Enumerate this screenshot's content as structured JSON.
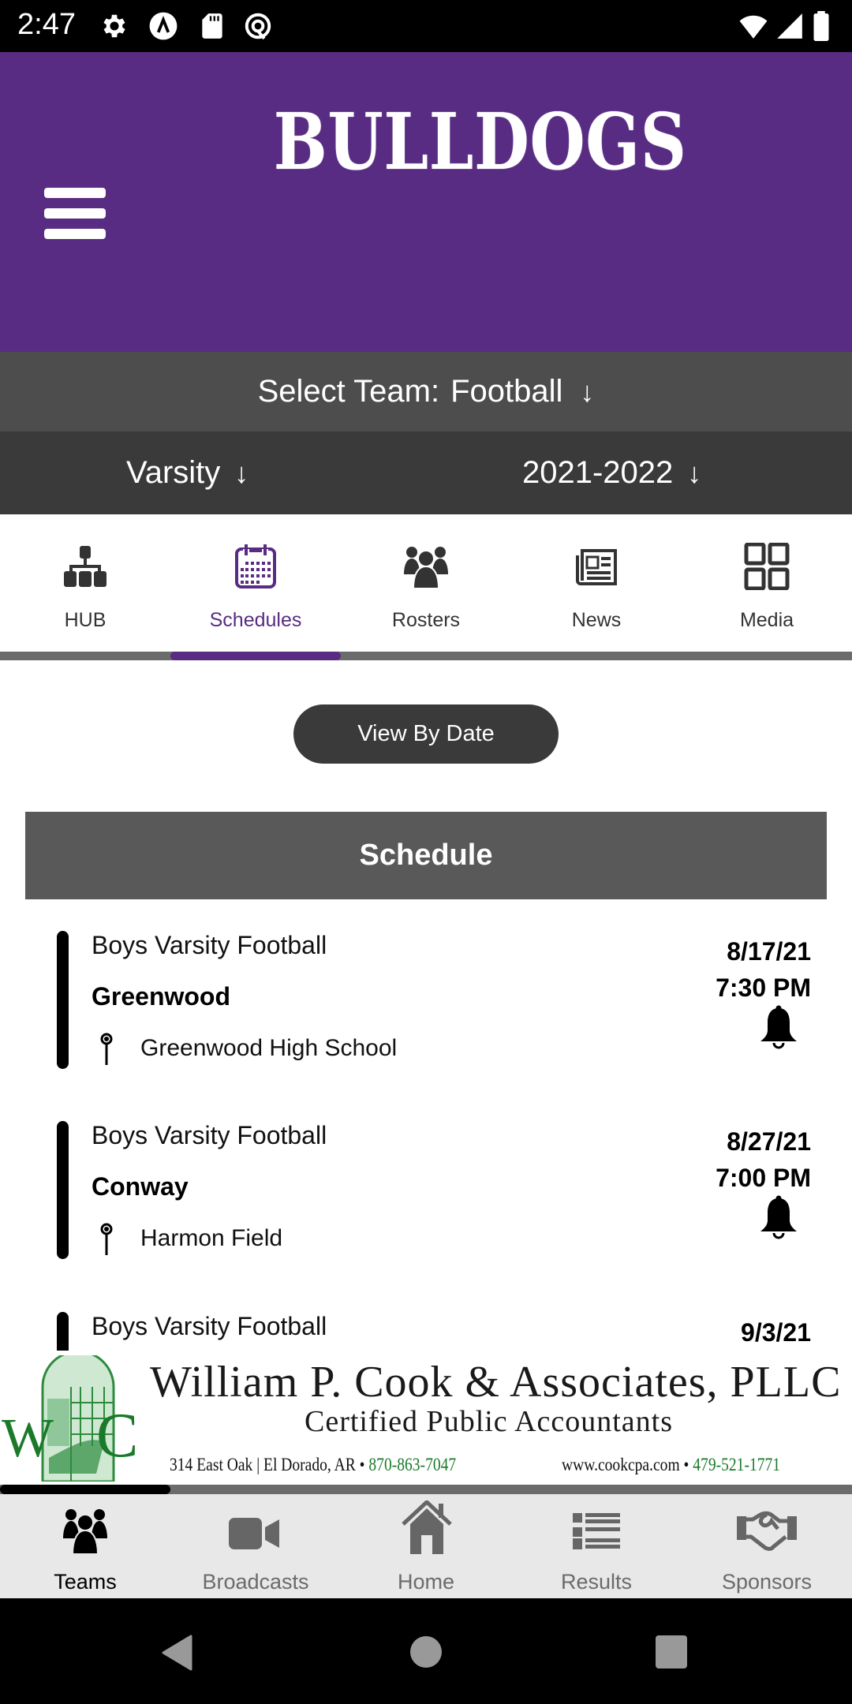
{
  "status_bar": {
    "time": "2:47",
    "left_icons": [
      "settings-icon",
      "app-a-icon",
      "sd-card-icon",
      "at-sign-icon"
    ],
    "right_icons": [
      "wifi-icon",
      "cell-signal-icon",
      "battery-icon"
    ]
  },
  "header": {
    "logo_text": "BULLDOGS",
    "brand_color": "#582c83"
  },
  "team_selector": {
    "label": "Select Team:",
    "value": "Football",
    "arrow": "↓"
  },
  "filters": {
    "level": "Varsity",
    "season": "2021-2022",
    "arrow": "↓"
  },
  "tabs": [
    {
      "label": "HUB",
      "icon": "hierarchy-icon",
      "active": false
    },
    {
      "label": "Schedules",
      "icon": "calendar-icon",
      "active": true
    },
    {
      "label": "Rosters",
      "icon": "users-icon",
      "active": false
    },
    {
      "label": "News",
      "icon": "newspaper-icon",
      "active": false
    },
    {
      "label": "Media",
      "icon": "grid-icon",
      "active": false
    }
  ],
  "view_button": "View By Date",
  "schedule": {
    "heading": "Schedule",
    "events": [
      {
        "title": "Boys Varsity Football",
        "opponent": "Greenwood",
        "location": "Greenwood High School",
        "date": "8/17/21",
        "time": "7:30 PM"
      },
      {
        "title": "Boys Varsity Football",
        "opponent": "Conway",
        "location": "Harmon Field",
        "date": "8/27/21",
        "time": "7:00 PM"
      },
      {
        "title": "Boys Varsity Football",
        "opponent": "",
        "location": "",
        "date": "9/3/21",
        "time": ""
      }
    ]
  },
  "ad": {
    "logo_letters": "WC",
    "firm": "William P. Cook & Associates, PLLC",
    "tagline": "Certified Public Accountants",
    "address": "314 East Oak | El Dorado, AR •",
    "phone1": "870-863-7047",
    "website": "www.cookcpa.com •",
    "phone2": "479-521-1771"
  },
  "bottom_nav": [
    {
      "label": "Teams",
      "icon": "users-icon",
      "active": true
    },
    {
      "label": "Broadcasts",
      "icon": "video-camera-icon",
      "active": false
    },
    {
      "label": "Home",
      "icon": "home-icon",
      "active": false
    },
    {
      "label": "Results",
      "icon": "list-icon",
      "active": false
    },
    {
      "label": "Sponsors",
      "icon": "handshake-icon",
      "active": false
    }
  ]
}
